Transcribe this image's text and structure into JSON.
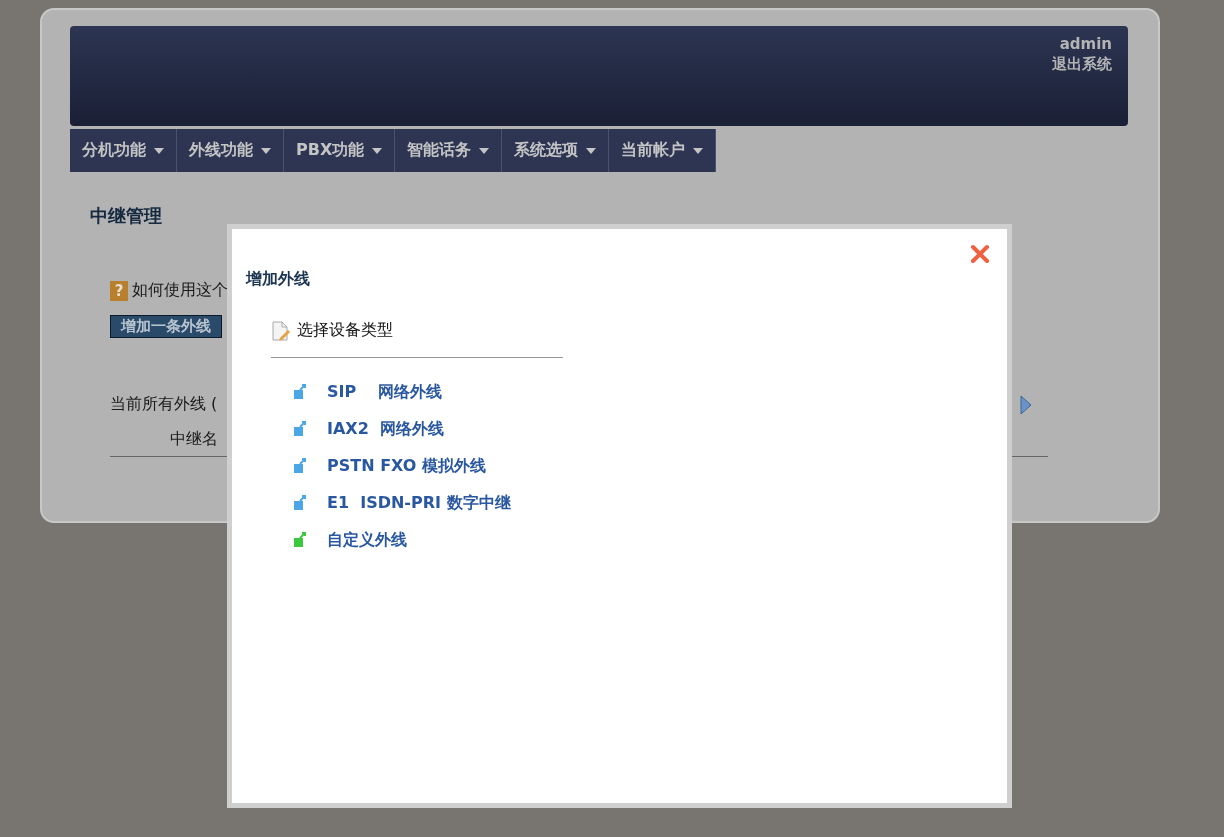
{
  "header": {
    "user": "admin",
    "logout": "退出系统"
  },
  "menu": [
    {
      "label": "分机功能"
    },
    {
      "label": "外线功能"
    },
    {
      "label": "PBX功能"
    },
    {
      "label": "智能话务"
    },
    {
      "label": "系统选项"
    },
    {
      "label": "当前帐户"
    }
  ],
  "page": {
    "title": "中继管理",
    "help_mark": "?",
    "help_text": "如何使用这个",
    "add_button": "增加一条外线",
    "list_label": "当前所有外线 (",
    "table": {
      "columns": [
        "中继名"
      ]
    }
  },
  "dialog": {
    "title": "增加外线",
    "prompt": "选择设备类型",
    "options": [
      {
        "label": "SIP    网络外线",
        "color": "#4aa6e6"
      },
      {
        "label": "IAX2  网络外线",
        "color": "#4aa6e6"
      },
      {
        "label": "PSTN FXO 模拟外线",
        "color": "#4aa6e6"
      },
      {
        "label": "E1  ISDN-PRI 数字中继",
        "color": "#4aa6e6"
      },
      {
        "label": "自定义外线",
        "color": "#3cc83c"
      }
    ]
  }
}
